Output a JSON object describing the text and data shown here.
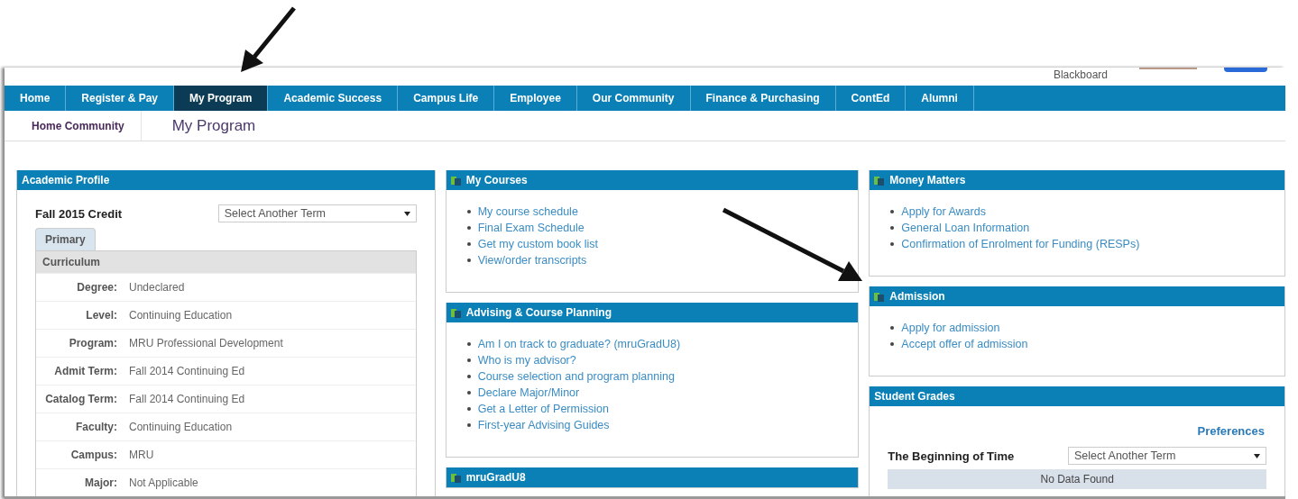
{
  "header": {
    "blackboard_label": "Blackboard"
  },
  "nav": [
    {
      "label": "Home",
      "selected": false
    },
    {
      "label": "Register & Pay",
      "selected": false
    },
    {
      "label": "My Program",
      "selected": true
    },
    {
      "label": "Academic Success",
      "selected": false
    },
    {
      "label": "Campus Life",
      "selected": false
    },
    {
      "label": "Employee",
      "selected": false
    },
    {
      "label": "Our Community",
      "selected": false
    },
    {
      "label": "Finance & Purchasing",
      "selected": false
    },
    {
      "label": "ContEd",
      "selected": false
    },
    {
      "label": "Alumni",
      "selected": false
    }
  ],
  "breadcrumb": {
    "home": "Home Community",
    "current": "My Program"
  },
  "academic_profile": {
    "title": "Academic Profile",
    "term": "Fall 2015 Credit",
    "term_select": {
      "value": "Select Another Term"
    },
    "tabs": [
      {
        "label": "Primary",
        "selected": true
      }
    ],
    "section": "Curriculum",
    "fields": [
      {
        "label": "Degree:",
        "value": "Undeclared"
      },
      {
        "label": "Level:",
        "value": "Continuing Education"
      },
      {
        "label": "Program:",
        "value": "MRU Professional Development"
      },
      {
        "label": "Admit Term:",
        "value": "Fall 2014 Continuing Ed"
      },
      {
        "label": "Catalog Term:",
        "value": "Fall 2014 Continuing Ed"
      },
      {
        "label": "Faculty:",
        "value": "Continuing Education"
      },
      {
        "label": "Campus:",
        "value": "MRU"
      },
      {
        "label": "Major:",
        "value": "Not Applicable"
      }
    ]
  },
  "columns": [
    [
      {
        "kind": "links",
        "title": "My Courses",
        "icon": true,
        "links": [
          "My course schedule",
          "Final Exam Schedule",
          "Get my custom book list",
          "View/order transcripts"
        ]
      },
      {
        "kind": "links",
        "title": "Advising & Course Planning",
        "icon": true,
        "links": [
          "Am I on track to graduate? (mruGradU8)",
          "Who is my advisor?",
          "Course selection and program planning",
          "Declare Major/Minor",
          "Get a Letter of Permission",
          "First-year Advising Guides"
        ]
      },
      {
        "kind": "links",
        "title": "mruGradU8",
        "icon": true
      }
    ],
    [
      {
        "kind": "links",
        "title": "Money Matters",
        "icon": true,
        "links": [
          "Apply for Awards",
          "General Loan Information",
          "Confirmation of Enrolment for Funding (RESPs)"
        ]
      },
      {
        "kind": "links",
        "title": "Admission",
        "icon": true,
        "links": [
          "Apply for admission",
          "Accept offer of admission"
        ]
      },
      {
        "kind": "grades",
        "title": "Student Grades",
        "icon": false,
        "preferences": "Preferences",
        "term": "The Beginning of Time",
        "term_select": {
          "value": "Select Another Term"
        },
        "empty_message": "No Data Found"
      }
    ]
  ]
}
